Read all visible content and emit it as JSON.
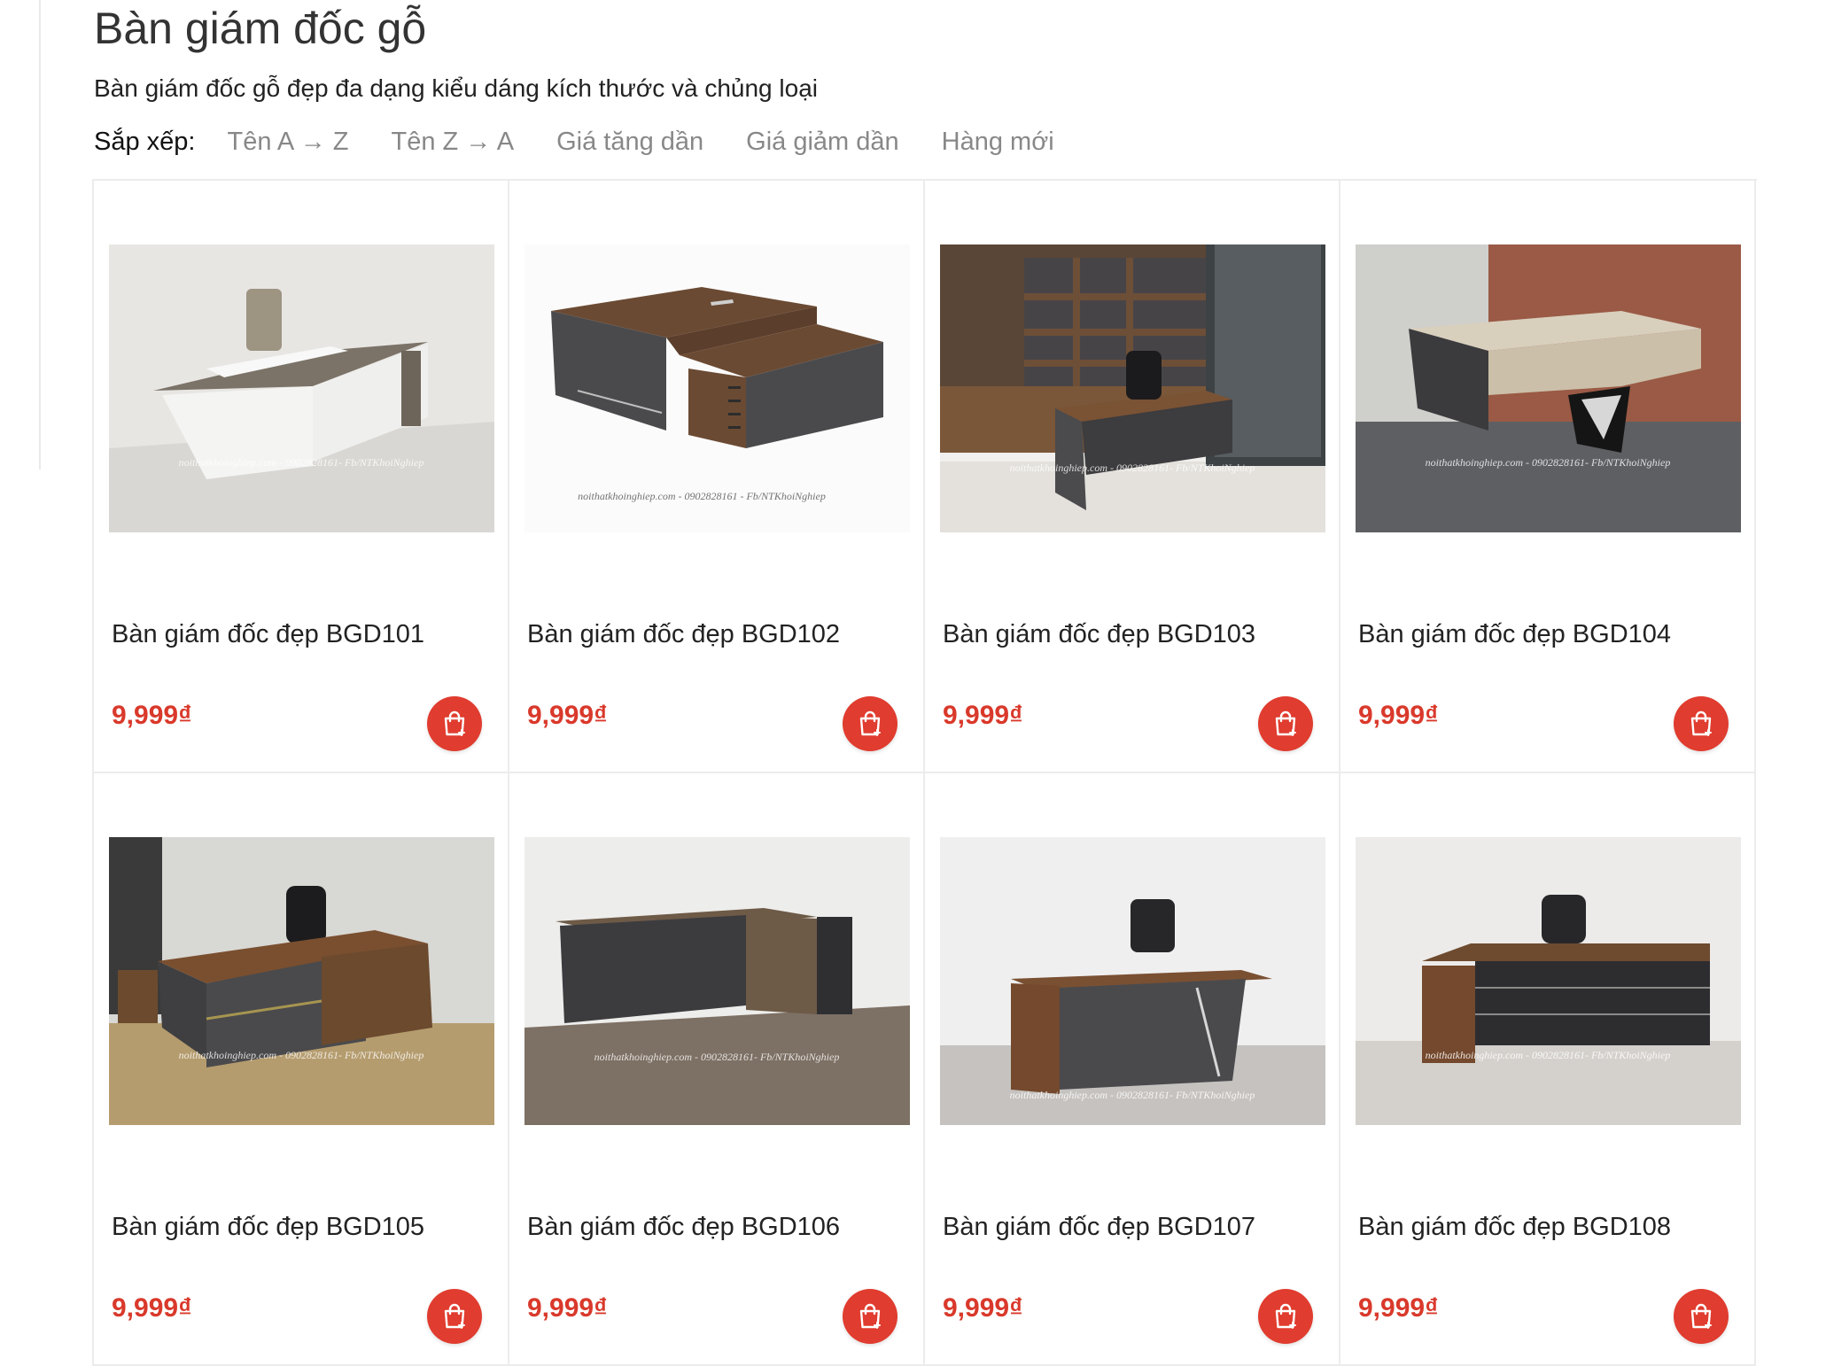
{
  "category": {
    "title": "Bàn giám đốc gỗ",
    "description": "Bàn giám đốc gỗ đẹp đa dạng kiểu dáng kích thước và chủng loại"
  },
  "sort": {
    "label": "Sắp xếp:",
    "options": [
      "Tên A → Z",
      "Tên Z → A",
      "Giá tăng dần",
      "Giá giảm dần",
      "Hàng mới"
    ]
  },
  "products": [
    {
      "name": "Bàn giám đốc đẹp BGD101",
      "price": "9,999₫",
      "watermark": "noithatkhoinghiep.com - 0902828161- Fb/NTKhoiNghiep"
    },
    {
      "name": "Bàn giám đốc đẹp BGD102",
      "price": "9,999₫",
      "watermark": "noithatkhoinghiep.com - 0902828161 - Fb/NTKhoiNghiep"
    },
    {
      "name": "Bàn giám đốc đẹp BGD103",
      "price": "9,999₫",
      "watermark": "noithatkhoinghiep.com - 0902828161- Fb/NTKhoiNghiep"
    },
    {
      "name": "Bàn giám đốc đẹp BGD104",
      "price": "9,999₫",
      "watermark": "noithatkhoinghiep.com - 0902828161- Fb/NTKhoiNghiep"
    },
    {
      "name": "Bàn giám đốc đẹp BGD105",
      "price": "9,999₫",
      "watermark": "noithatkhoinghiep.com - 0902828161- Fb/NTKhoiNghiep"
    },
    {
      "name": "Bàn giám đốc đẹp BGD106",
      "price": "9,999₫",
      "watermark": "noithatkhoinghiep.com - 0902828161- Fb/NTKhoiNghiep"
    },
    {
      "name": "Bàn giám đốc đẹp BGD107",
      "price": "9,999₫",
      "watermark": "noithatkhoinghiep.com - 0902828161- Fb/NTKhoiNghiep"
    },
    {
      "name": "Bàn giám đốc đẹp BGD108",
      "price": "9,999₫",
      "watermark": "noithatkhoinghiep.com - 0902828161- Fb/NTKhoiNghiep"
    }
  ],
  "icons": {
    "cart": "shopping-bag-add-icon"
  },
  "colors": {
    "accent": "#e03c2f",
    "price": "#d9392b"
  }
}
